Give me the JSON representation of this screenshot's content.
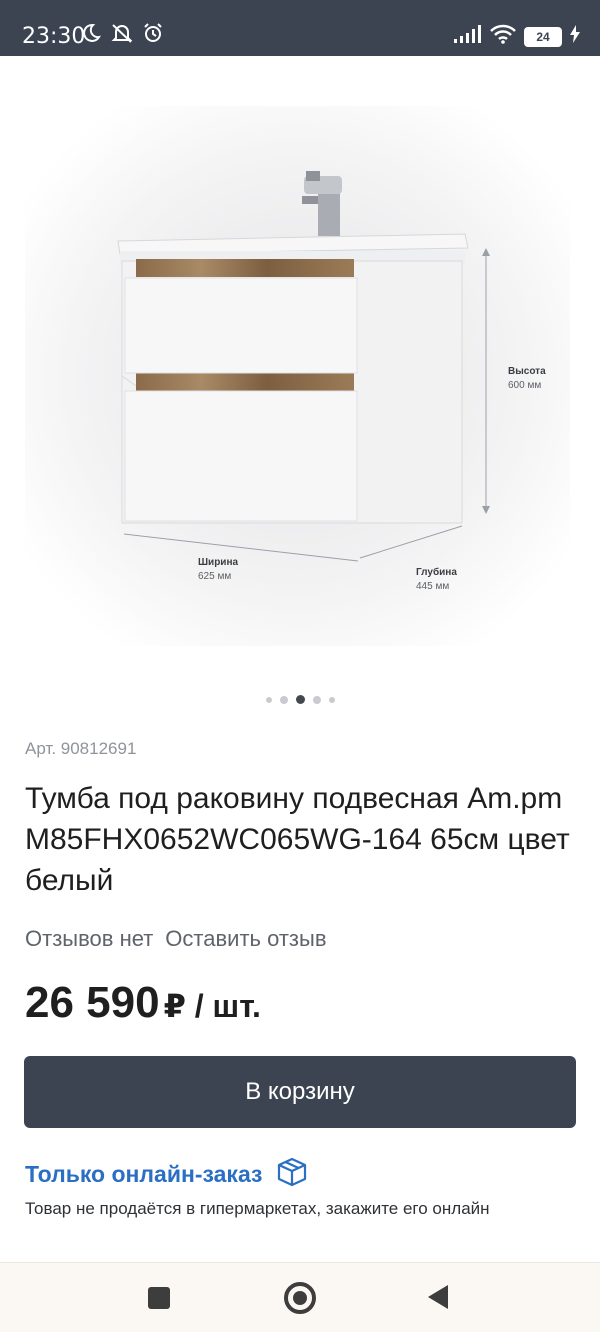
{
  "status_bar": {
    "time": "23:30",
    "battery": "24",
    "icons": [
      "moon-icon",
      "notifications-off-icon",
      "alarm-icon",
      "signal-icon",
      "wifi-icon",
      "battery-icon",
      "charging-icon"
    ]
  },
  "product": {
    "image": {
      "dimension_labels": {
        "height_label": "Высота",
        "height_value": "600 мм",
        "width_label": "Ширина",
        "width_value": "625 мм",
        "depth_label": "Глубина",
        "depth_value": "445 мм"
      }
    },
    "carousel": {
      "total": 5,
      "active_index": 2
    },
    "article": "Арт. 90812691",
    "title": "Тумба под раковину подвесная Am.pm M85FHX0652WC065WG-164 65см цвет белый",
    "reviews_none": "Отзывов нет",
    "leave_review": "Оставить отзыв",
    "price_value": "26 590",
    "price_unit": "₽ / шт.",
    "cart_button": "В корзину",
    "online_only_label": "Только онлайн-заказ",
    "online_note": "Товар не продаётся в гипермаркетах, закажите его онлайн"
  },
  "colors": {
    "primary_dark": "#3d4451",
    "link_blue": "#2b6fc4"
  }
}
